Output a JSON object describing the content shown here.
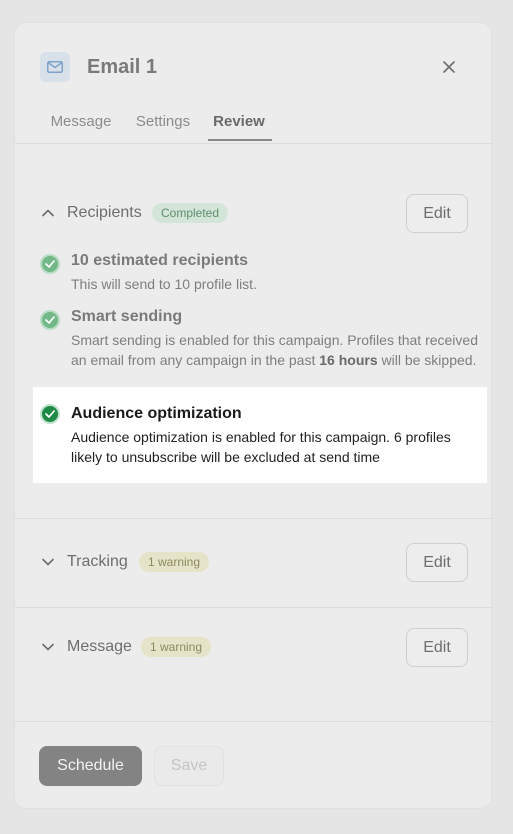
{
  "header": {
    "title": "Email 1",
    "icon": "envelope-icon",
    "close_icon": "close-icon"
  },
  "tabs": [
    {
      "label": "Message",
      "active": false
    },
    {
      "label": "Settings",
      "active": false
    },
    {
      "label": "Review",
      "active": true
    }
  ],
  "recipients": {
    "title": "Recipients",
    "badge": "Completed",
    "edit_label": "Edit",
    "items": [
      {
        "title": "10 estimated recipients",
        "desc": "This will send to 10 profile list."
      },
      {
        "title": "Smart sending",
        "desc_pre": "Smart sending is enabled for this campaign. Profiles that received an email from any campaign in the past ",
        "desc_bold": "16 hours",
        "desc_post": " will be skipped."
      },
      {
        "title": "Audience optimization",
        "desc": "Audience optimization is enabled for this campaign. 6 profiles likely to unsubscribe will be excluded at send time"
      }
    ]
  },
  "tracking": {
    "title": "Tracking",
    "badge": "1 warning",
    "edit_label": "Edit"
  },
  "message": {
    "title": "Message",
    "badge": "1 warning",
    "edit_label": "Edit"
  },
  "footer": {
    "schedule_label": "Schedule",
    "save_label": "Save"
  },
  "colors": {
    "success": "#1f8a45",
    "warning_badge": "#e6e4c8",
    "completed_badge": "#d3e5d9"
  }
}
